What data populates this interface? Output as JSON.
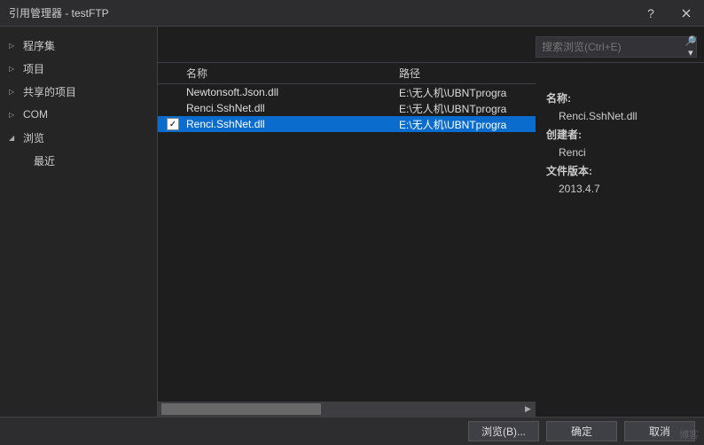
{
  "window": {
    "title": "引用管理器 - testFTP"
  },
  "sidebar": {
    "items": [
      {
        "label": "程序集",
        "expanded": false
      },
      {
        "label": "项目",
        "expanded": false
      },
      {
        "label": "共享的项目",
        "expanded": false
      },
      {
        "label": "COM",
        "expanded": false
      },
      {
        "label": "浏览",
        "expanded": true
      }
    ],
    "sub": {
      "label": "最近"
    }
  },
  "search": {
    "placeholder": "搜索浏览(Ctrl+E)"
  },
  "columns": {
    "name": "名称",
    "path": "路径"
  },
  "rows": [
    {
      "checked": false,
      "name": "Newtonsoft.Json.dll",
      "path": "E:\\无人机\\UBNTprogra",
      "selected": false
    },
    {
      "checked": false,
      "name": "Renci.SshNet.dll",
      "path": "E:\\无人机\\UBNTprogra",
      "selected": false
    },
    {
      "checked": true,
      "name": "Renci.SshNet.dll",
      "path": "E:\\无人机\\UBNTprogra",
      "selected": true
    }
  ],
  "detail": {
    "name_label": "名称:",
    "name_value": "Renci.SshNet.dll",
    "creator_label": "创建者:",
    "creator_value": "Renci",
    "version_label": "文件版本:",
    "version_value": "2013.4.7"
  },
  "footer": {
    "browse": "浏览(B)...",
    "ok": "确定",
    "cancel": "取消"
  },
  "watermark": "博客"
}
